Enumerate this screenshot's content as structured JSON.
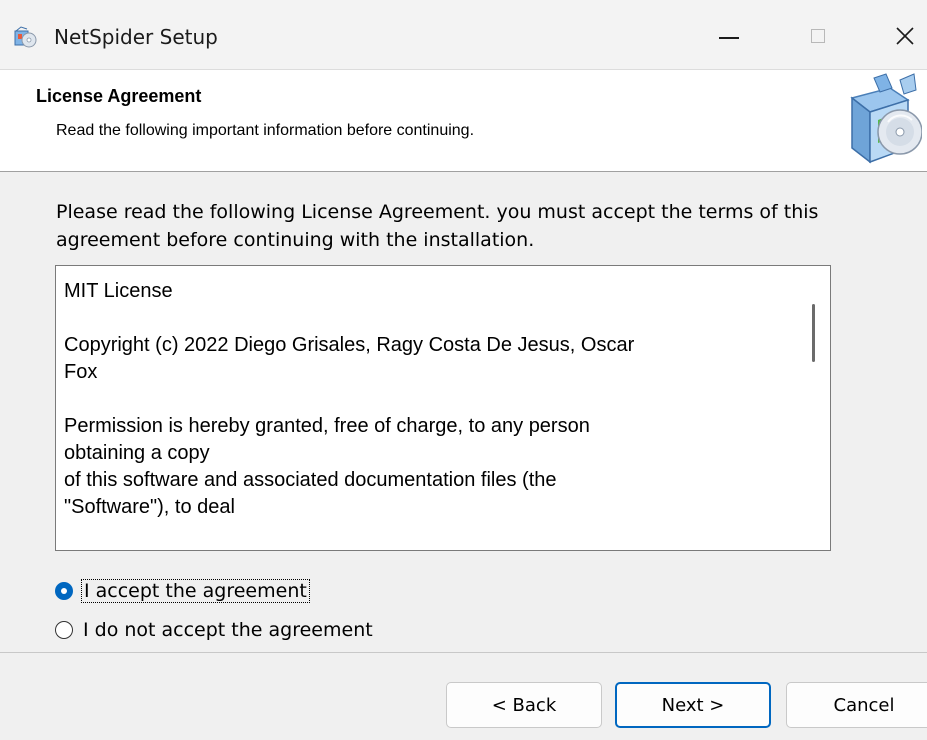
{
  "window": {
    "title": "NetSpider Setup"
  },
  "titlebar": {
    "minimize_icon": "minimize-icon",
    "maximize_icon": "maximize-icon",
    "close_icon": "close-icon",
    "close_glyph": "✕"
  },
  "header": {
    "title": "License Agreement",
    "subtitle": "Read the following important information before continuing.",
    "logo_icon": "installer-box-cd-icon"
  },
  "body": {
    "intro": "Please read the following License Agreement. you must accept the terms of this agreement before continuing with the installation.",
    "license_text": "MIT License\n\nCopyright (c) 2022 Diego Grisales, Ragy Costa De Jesus, Oscar\nFox\n\nPermission is hereby granted, free of charge, to any person\nobtaining a copy\nof this software and associated documentation files (the\n\"Software\"), to deal"
  },
  "options": {
    "accept_label": "I accept the agreement",
    "decline_label": "I do not accept the agreement",
    "selected": "accept"
  },
  "buttons": {
    "back": "< Back",
    "next": "Next >",
    "cancel": "Cancel"
  },
  "colors": {
    "accent": "#0067c0",
    "window_bg": "#f0f0f0",
    "header_bg": "#ffffff"
  }
}
